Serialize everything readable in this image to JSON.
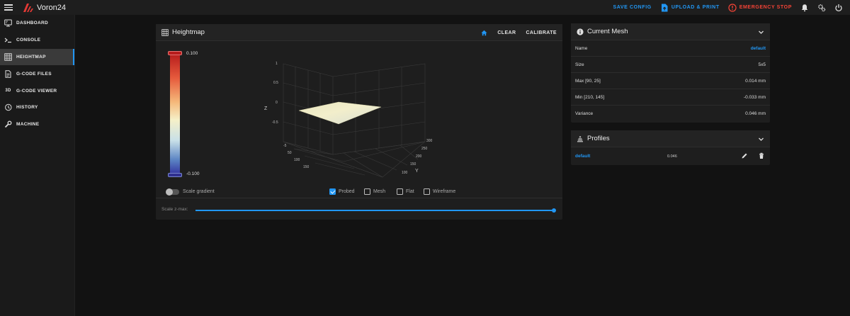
{
  "app": {
    "title": "Voron24"
  },
  "topbar": {
    "save_config": "SAVE CONFIG",
    "upload_print": "UPLOAD & PRINT",
    "emergency_stop": "EMERGENCY STOP"
  },
  "sidebar": {
    "items": [
      {
        "label": "DASHBOARD",
        "icon": "monitor-dashboard-icon"
      },
      {
        "label": "CONSOLE",
        "icon": "console-icon"
      },
      {
        "label": "HEIGHTMAP",
        "icon": "grid-icon",
        "active": true
      },
      {
        "label": "G-CODE FILES",
        "icon": "file-document-icon"
      },
      {
        "label": "G-CODE VIEWER",
        "icon": "3d-icon",
        "icon_text": "3D"
      },
      {
        "label": "HISTORY",
        "icon": "history-icon"
      },
      {
        "label": "MACHINE",
        "icon": "wrench-icon"
      }
    ]
  },
  "heightmap": {
    "title": "Heightmap",
    "clear_label": "CLEAR",
    "calibrate_label": "CALIBRATE",
    "colorbar_max": "0.100",
    "colorbar_min": "-0.100",
    "scale_gradient_label": "Scale gradient",
    "scale_gradient_on": false,
    "checkboxes": [
      {
        "label": "Probed",
        "checked": true
      },
      {
        "label": "Mesh",
        "checked": false
      },
      {
        "label": "Flat",
        "checked": false
      },
      {
        "label": "Wireframe",
        "checked": false
      }
    ],
    "scale_zmax_label": "Scale z-max:",
    "scale_zmax_value": 1.0,
    "plot": {
      "z_axis_label": "Z",
      "y_axis_label": "Y",
      "z_ticks": [
        "1",
        "0.5",
        "0",
        "-0.5"
      ],
      "x_ticks": [
        "-5",
        "50",
        "100",
        "150"
      ],
      "y_ticks": [
        "300",
        "250",
        "200",
        "150",
        "100"
      ]
    }
  },
  "current_mesh": {
    "title": "Current Mesh",
    "rows": [
      {
        "label": "Name",
        "value": "default",
        "link": true
      },
      {
        "label": "Size",
        "value": "5x5"
      },
      {
        "label": "Max [90, 25]",
        "value": "0.014 mm"
      },
      {
        "label": "Min [210, 145]",
        "value": "-0.033 mm"
      },
      {
        "label": "Variance",
        "value": "0.046 mm"
      }
    ]
  },
  "profiles": {
    "title": "Profiles",
    "items": [
      {
        "name": "default",
        "variance": "0.046"
      }
    ]
  },
  "colors": {
    "accent": "#2196f3",
    "danger": "#f44336",
    "background": "#121212",
    "card": "#1e1e1e"
  }
}
